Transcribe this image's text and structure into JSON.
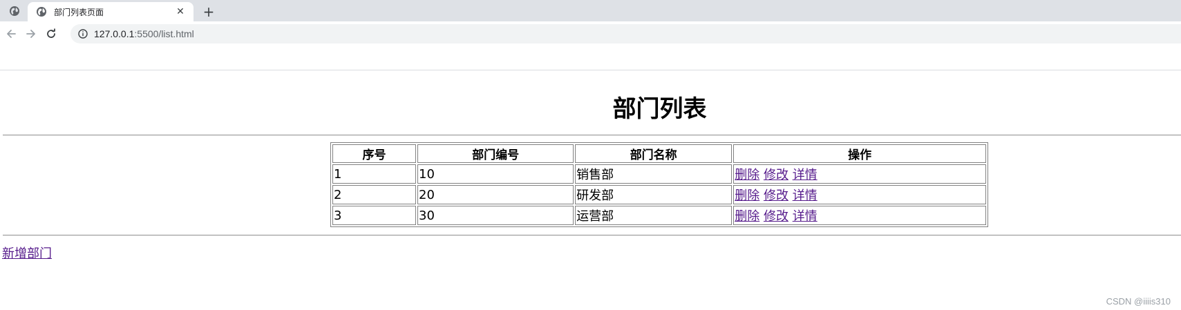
{
  "browser": {
    "tab_title": "部门列表页面",
    "tab_close": "✕",
    "new_tab": "+",
    "url_host": "127.0.0.1",
    "url_path": ":5500/list.html"
  },
  "page": {
    "title": "部门列表",
    "table": {
      "headers": [
        "序号",
        "部门编号",
        "部门名称",
        "操作"
      ],
      "rows": [
        {
          "seq": "1",
          "dept_no": "10",
          "dept_name": "销售部",
          "actions": [
            "删除",
            "修改",
            "详情"
          ]
        },
        {
          "seq": "2",
          "dept_no": "20",
          "dept_name": "研发部",
          "actions": [
            "删除",
            "修改",
            "详情"
          ]
        },
        {
          "seq": "3",
          "dept_no": "30",
          "dept_name": "运营部",
          "actions": [
            "删除",
            "修改",
            "详情"
          ]
        }
      ]
    },
    "add_link": "新增部门"
  },
  "watermark": "CSDN @iiiis310",
  "colors": {
    "tabstrip_bg": "#dee1e6",
    "omnibox_bg": "#f1f3f4",
    "visited_link": "#551a8b"
  },
  "icons": {
    "pinned_tab": "globe-icon",
    "tab_favicon": "globe-icon",
    "back": "arrow-left-icon",
    "forward": "arrow-right-icon",
    "reload": "reload-icon",
    "site_info": "info-icon"
  }
}
